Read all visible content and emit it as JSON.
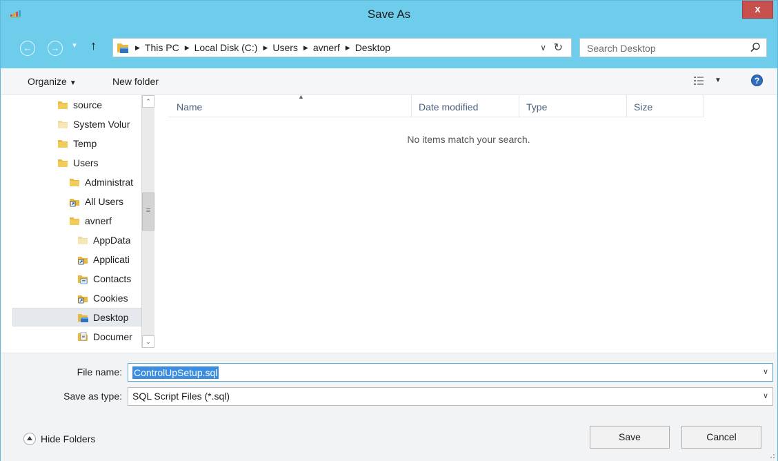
{
  "window": {
    "title": "Save As",
    "close_label": "x"
  },
  "nav": {
    "back_icon": "back-arrow-icon",
    "forward_icon": "forward-arrow-icon",
    "recent_icon": "chevron-down-icon",
    "up_icon": "up-arrow-icon"
  },
  "breadcrumb": {
    "items": [
      "This PC",
      "Local Disk (C:)",
      "Users",
      "avnerf",
      "Desktop"
    ]
  },
  "search": {
    "placeholder": "Search Desktop"
  },
  "toolbar": {
    "organize": "Organize",
    "new_folder": "New folder"
  },
  "tree": {
    "items": [
      {
        "label": "source",
        "icon": "folder-icon",
        "level": 0
      },
      {
        "label": "System Volur",
        "icon": "folder-light-icon",
        "level": 0
      },
      {
        "label": "Temp",
        "icon": "folder-icon",
        "level": 0
      },
      {
        "label": "Users",
        "icon": "folder-icon",
        "level": 0
      },
      {
        "label": "Administrat",
        "icon": "folder-icon",
        "level": 1
      },
      {
        "label": "All Users",
        "icon": "shortcut-icon",
        "level": 1
      },
      {
        "label": "avnerf",
        "icon": "folder-icon",
        "level": 1
      },
      {
        "label": "AppData",
        "icon": "folder-light-icon",
        "level": 2
      },
      {
        "label": "Applicati",
        "icon": "shortcut-icon",
        "level": 2
      },
      {
        "label": "Contacts",
        "icon": "contacts-folder-icon",
        "level": 2
      },
      {
        "label": "Cookies",
        "icon": "shortcut-icon",
        "level": 2
      },
      {
        "label": "Desktop",
        "icon": "desktop-folder-icon",
        "level": 2,
        "selected": true
      },
      {
        "label": "Documer",
        "icon": "documents-folder-icon",
        "level": 2
      }
    ]
  },
  "columns": {
    "name": "Name",
    "date_modified": "Date modified",
    "type": "Type",
    "size": "Size"
  },
  "empty_message": "No items match your search.",
  "form": {
    "file_name_label": "File name:",
    "file_name_value": "ControlUpSetup.sql",
    "save_type_label": "Save as type:",
    "save_type_value": "SQL Script Files (*.sql)"
  },
  "footer": {
    "hide_folders": "Hide Folders",
    "save": "Save",
    "cancel": "Cancel"
  },
  "colors": {
    "titlebar": "#6ecdeb",
    "close": "#c7504c",
    "selection": "#3a8de0",
    "folder": "#e8b93c"
  }
}
